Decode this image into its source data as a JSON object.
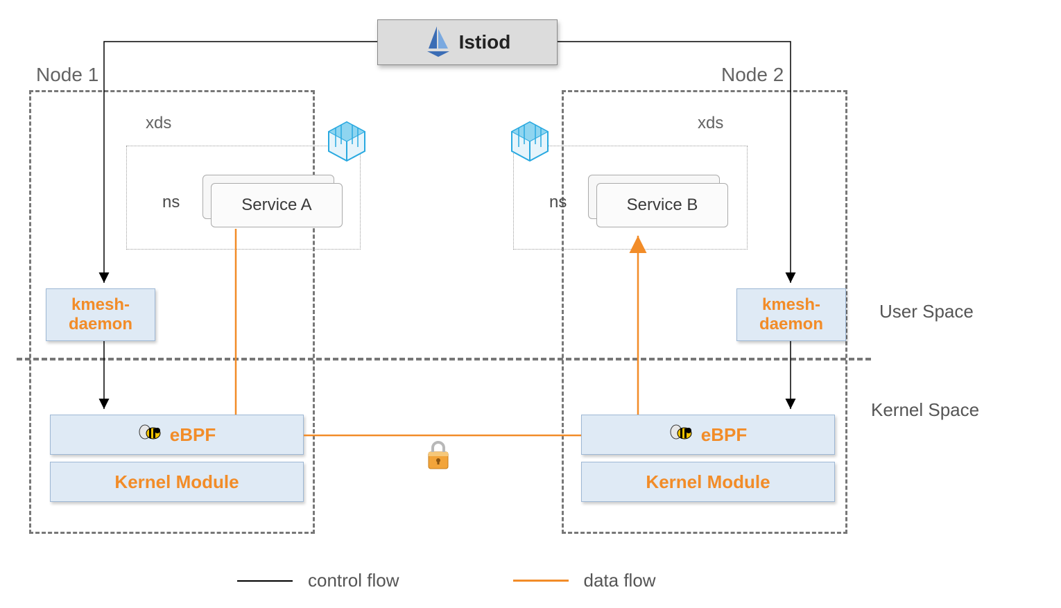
{
  "istiod": {
    "label": "Istiod"
  },
  "nodes": {
    "n1": {
      "title": "Node 1",
      "xds": "xds",
      "ns": "ns",
      "service": "Service A",
      "kmesh": "kmesh-\ndaemon",
      "ebpf": "eBPF",
      "km": "Kernel Module"
    },
    "n2": {
      "title": "Node 2",
      "xds": "xds",
      "ns": "ns",
      "service": "Service B",
      "kmesh": "kmesh-\ndaemon",
      "ebpf": "eBPF",
      "km": "Kernel Module"
    }
  },
  "space": {
    "user": "User  Space",
    "kernel": "Kernel Space"
  },
  "legend": {
    "control": "control flow",
    "data": "data flow"
  },
  "colors": {
    "orange": "#f28c28",
    "blueBox": "#dfeaf5",
    "gray": "#777"
  }
}
